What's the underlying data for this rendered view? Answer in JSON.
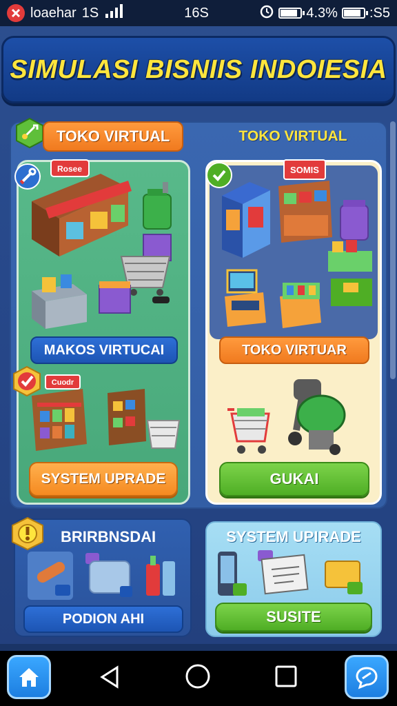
{
  "status_bar": {
    "app_name": "loaehar",
    "network": "1S",
    "center_time": "16S",
    "battery_text": "4.3%",
    "right_time": ":S5",
    "battery_level": 0.85
  },
  "title": "SIMULASI BISNIIS INDOIESIA",
  "left_panel": {
    "header_label": "TOKO VIRTUAL",
    "shop_sign": "Rosee",
    "middle_label": "MAKOS VIRTUCAI",
    "sub_sign": "Cuodr",
    "button_label": "SYSTEM UPRADE"
  },
  "right_panel": {
    "header_label": "TOKO VIRTUAL",
    "shop_sign": "SOMIS",
    "middle_label": "TOKO VIRTUAR",
    "button_label": "GUKAI"
  },
  "bottom_left": {
    "title": "BRIRBNSDAI",
    "button_label": "PODION AHI"
  },
  "bottom_right": {
    "title": "SYSTEM UPIRADE",
    "button_label": "SUSITE"
  },
  "icons": {
    "badge_top_left": "sword-shield-icon",
    "badge_left_tool": "wrench-icon",
    "badge_right_check": "check-icon",
    "badge_checkmark": "checkmark-badge-icon",
    "badge_info": "exclamation-icon",
    "nav_home": "home-icon",
    "nav_back": "back-triangle-icon",
    "nav_home_circle": "home-circle-icon",
    "nav_recent": "recent-square-icon",
    "nav_chat": "chat-bubble-icon"
  },
  "colors": {
    "title_yellow": "#ffe53d",
    "panel_green": "#58b98a",
    "panel_cream": "#fbefc8",
    "accent_orange": "#f58a21",
    "accent_green": "#4fae25",
    "accent_blue": "#1d55b4"
  }
}
